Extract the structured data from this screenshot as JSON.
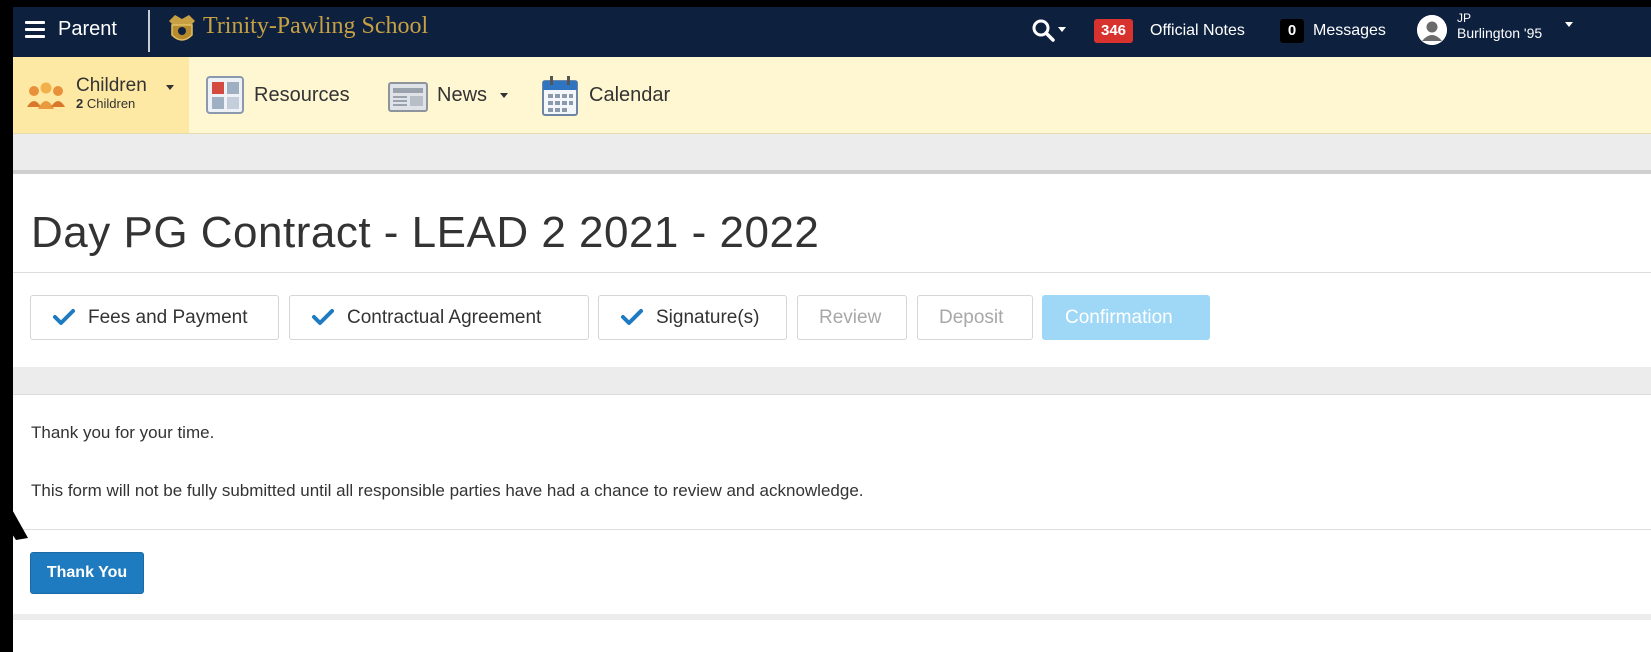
{
  "topnav": {
    "role_label": "Parent",
    "school_name": "Trinity-Pawling School",
    "official_notes_count": "346",
    "official_notes_label": "Official Notes",
    "messages_count": "0",
    "messages_label": "Messages",
    "user_initials": "JP",
    "user_class": "Burlington '95",
    "icons": [
      "hamburger-icon",
      "crest-icon",
      "search-icon",
      "avatar-icon"
    ],
    "colors": {
      "background": "#0d213f",
      "brand_gold": "#c7a044",
      "notes_badge": "#d8322e"
    }
  },
  "subnav": {
    "children_label": "Children",
    "children_count_num": "2",
    "children_count_word": "Children",
    "resources_label": "Resources",
    "news_label": "News",
    "calendar_label": "Calendar",
    "colors": {
      "background": "#fff6d2",
      "active": "#fde9a3"
    }
  },
  "page": {
    "title": "Day PG Contract - LEAD 2 2021 - 2022"
  },
  "steps": [
    {
      "label": "Fees and Payment",
      "state": "complete"
    },
    {
      "label": "Contractual Agreement",
      "state": "complete"
    },
    {
      "label": "Signature(s)",
      "state": "complete"
    },
    {
      "label": "Review",
      "state": "disabled"
    },
    {
      "label": "Deposit",
      "state": "disabled"
    },
    {
      "label": "Confirmation",
      "state": "current"
    }
  ],
  "content": {
    "thanks": "Thank you for your time.",
    "notice": "This form will not be fully submitted until all responsible parties have had a chance to review and acknowledge.",
    "button_label": "Thank You",
    "colors": {
      "button": "#1f7bc0",
      "check": "#1f7bc0"
    }
  }
}
